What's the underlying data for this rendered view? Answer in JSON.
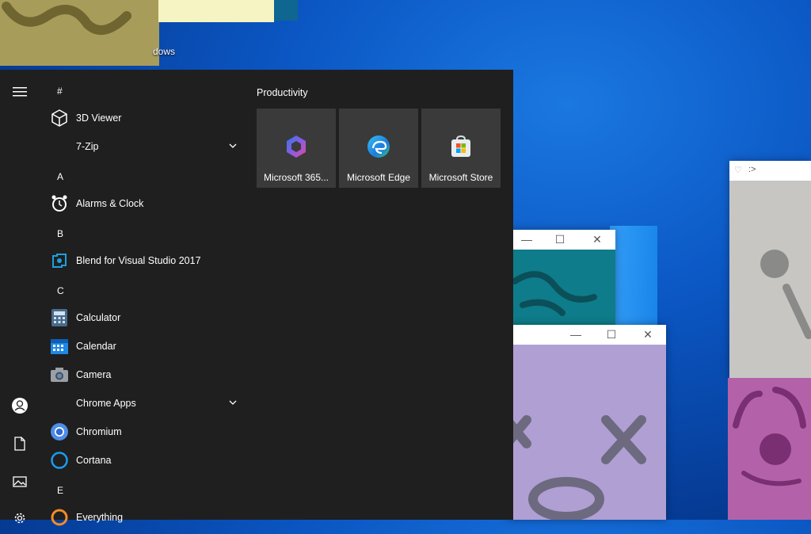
{
  "desktop": {
    "icon_label_fragment": "dows"
  },
  "start_menu": {
    "rail": {
      "menu_icon": "hamburger-icon",
      "user_icon": "user-icon",
      "documents_icon": "document-icon",
      "pictures_icon": "pictures-icon",
      "settings_icon": "gear-icon"
    },
    "app_list": {
      "groups": [
        {
          "letter": "#",
          "apps": [
            {
              "name": "3D Viewer",
              "icon": "cube-icon"
            },
            {
              "name": "7-Zip",
              "icon": "none",
              "expandable": true
            }
          ]
        },
        {
          "letter": "A",
          "apps": [
            {
              "name": "Alarms & Clock",
              "icon": "alarm-clock-icon"
            }
          ]
        },
        {
          "letter": "B",
          "apps": [
            {
              "name": "Blend for Visual Studio 2017",
              "icon": "blend-icon"
            }
          ]
        },
        {
          "letter": "C",
          "apps": [
            {
              "name": "Calculator",
              "icon": "calculator-icon"
            },
            {
              "name": "Calendar",
              "icon": "calendar-icon"
            },
            {
              "name": "Camera",
              "icon": "camera-icon"
            },
            {
              "name": "Chrome Apps",
              "icon": "none",
              "expandable": true
            },
            {
              "name": "Chromium",
              "icon": "chromium-icon"
            },
            {
              "name": "Cortana",
              "icon": "cortana-icon"
            }
          ]
        },
        {
          "letter": "E",
          "apps": [
            {
              "name": "Everything",
              "icon": "everything-icon"
            }
          ]
        }
      ]
    },
    "tiles": {
      "group_title": "Productivity",
      "items": [
        {
          "label": "Microsoft 365...",
          "icon": "microsoft-365-icon"
        },
        {
          "label": "Microsoft Edge",
          "icon": "edge-icon"
        },
        {
          "label": "Microsoft Store",
          "icon": "store-icon"
        }
      ]
    }
  },
  "windows": {
    "gray_title": ":>"
  },
  "colors": {
    "start_bg": "#1f1f1f",
    "tile_bg": "#3a3a3a",
    "accent": "#0078d7"
  }
}
